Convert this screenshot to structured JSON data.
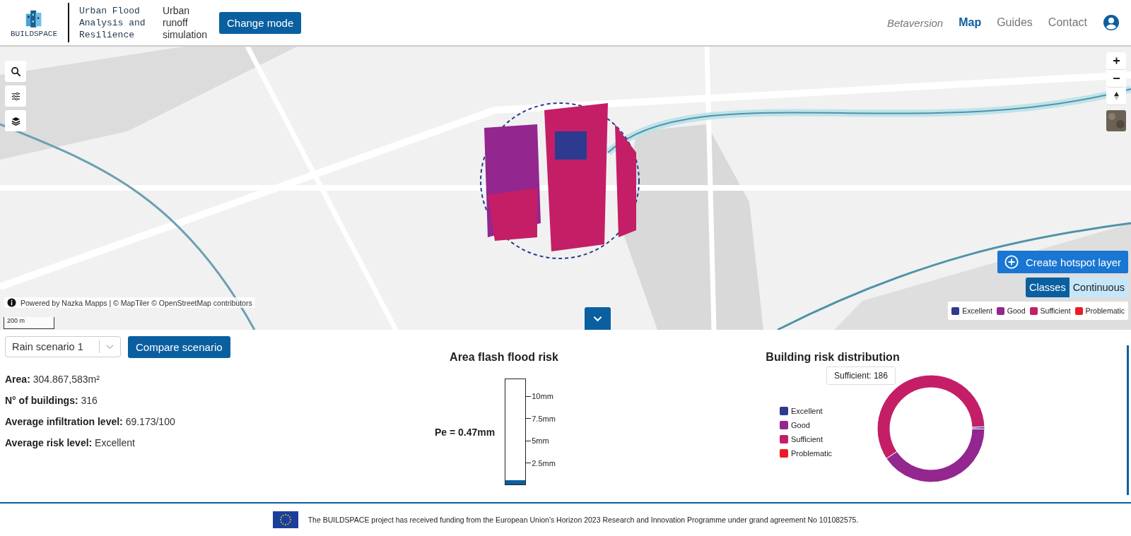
{
  "header": {
    "logo_text": "BUILDSPACE",
    "app_title": "Urban Flood Analysis and Resilience",
    "mode": "Urban runoff simulation",
    "mode_button": "Change mode",
    "nav": [
      {
        "label": "Betaversion",
        "kind": "note"
      },
      {
        "label": "Map",
        "kind": "link",
        "selected": true
      },
      {
        "label": "Guides",
        "kind": "link",
        "selected": false
      },
      {
        "label": "Contact",
        "kind": "link",
        "selected": false
      }
    ]
  },
  "map": {
    "attribution": "Powered by Nazka Mapps | © MapTiler © OpenStreetMap contributors",
    "scale": "200 m",
    "hotspot_button": "Create hotspot layer",
    "view_modes": [
      {
        "label": "Classes",
        "selected": true
      },
      {
        "label": "Continuous",
        "selected": false
      }
    ],
    "legend": [
      {
        "label": "Excellent",
        "color": "#2e3a8f"
      },
      {
        "label": "Good",
        "color": "#93268f"
      },
      {
        "label": "Sufficient",
        "color": "#c41e66"
      },
      {
        "label": "Problematic",
        "color": "#ec1c24"
      }
    ]
  },
  "scenario": {
    "select": "Rain scenario 1",
    "compare_button": "Compare scenario"
  },
  "stats": [
    {
      "label": "Area:",
      "value": "304.867,583m²"
    },
    {
      "label": "N° of buildings:",
      "value": "316"
    },
    {
      "label": "Average infiltration level:",
      "value": "69.173/100"
    },
    {
      "label": "Average risk level:",
      "value": "Excellent"
    }
  ],
  "flood_risk": {
    "title": "Area flash flood risk",
    "reading": "Pe = 0.47mm",
    "level": 0.04,
    "ticks": [
      "10mm",
      "7.5mm",
      "5mm",
      "2.5mm"
    ]
  },
  "risk_distribution": {
    "title": "Building risk distribution",
    "tooltip": "Sufficient: 186",
    "legend": [
      {
        "label": "Excellent",
        "color": "#2e3a8f"
      },
      {
        "label": "Good",
        "color": "#93268f"
      },
      {
        "label": "Sufficient",
        "color": "#c41e66"
      },
      {
        "label": "Problematic",
        "color": "#ec1c24"
      }
    ]
  },
  "footer": {
    "text": "The BUILDSPACE project has received funding from the European Union's Horizon 2023 Research and Innovation Programme under grand agreement No 101082575."
  }
}
